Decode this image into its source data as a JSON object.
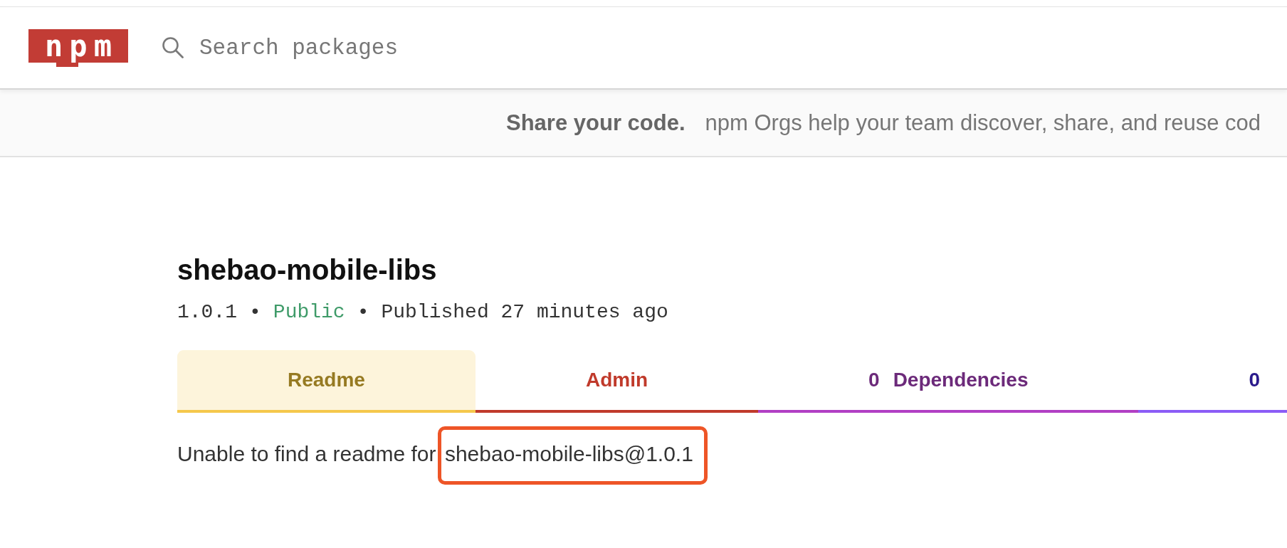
{
  "header": {
    "logo": "npm",
    "search": {
      "placeholder": "Search packages"
    }
  },
  "banner": {
    "headline": "Share your code.",
    "text": "npm Orgs help your team discover, share, and reuse cod"
  },
  "package": {
    "name": "shebao-mobile-libs",
    "meta": [
      {
        "kind": "version",
        "text": "1.0.1"
      },
      {
        "kind": "separator",
        "text": "•"
      },
      {
        "kind": "visibility",
        "text": "Public"
      },
      {
        "kind": "separator",
        "text": "•"
      },
      {
        "kind": "published",
        "text": "Published 27 minutes ago"
      }
    ]
  },
  "tabs": [
    {
      "label": "Readme",
      "selected": true,
      "color": "#967a22",
      "underline": {
        "color": "#f5c84c"
      }
    },
    {
      "label": "Admin",
      "selected": false,
      "color": "#c03a2b",
      "underline": {
        "color": "#c03a2b"
      }
    },
    {
      "count": "0",
      "label": "Dependencies",
      "selected": false,
      "color": "#6c2a7a",
      "underline": {
        "color": "#b13fc4"
      }
    },
    {
      "count": "0",
      "selected": false,
      "color": "#2a1a8c",
      "underline": {
        "color": "#8b5cf6"
      }
    }
  ],
  "readme": {
    "message": "Unable to find a readme for",
    "package": "shebao-mobile-libs@1.0.1",
    "highlighted": true
  }
}
